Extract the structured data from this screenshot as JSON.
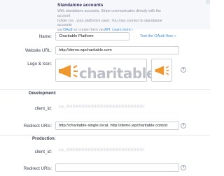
{
  "standalone": {
    "title": "Standalone accounts",
    "text_1": "With standalone accounts, Stripe communicates directly with the account",
    "text_2": "holder (i.e., your platform's user). You may connect to standalone accounts",
    "text_3_prefix": "via ",
    "text_3_link1": "OAuth",
    "text_3_mid": " or create them via ",
    "text_3_link2": "API",
    "text_3_sep": ". ",
    "text_3_link3": "Learn more ›"
  },
  "form": {
    "name_label": "Name:",
    "name_value": "Charitable Platform",
    "test_oauth_link": "Test the OAuth flow »",
    "website_label": "Website URL:",
    "website_value": "http://demo.wpcharitable.com",
    "logo_label": "Logo & Icon:",
    "logo_text": "charitable",
    "help_glyph": "?"
  },
  "development": {
    "section_label": "Development:",
    "client_id_label": "client_id:",
    "client_id_value": "ca_XXXXXXXXXXXXXXXXXXXXXXXXXXXXXXXXX",
    "redirect_label": "Redirect URIs:",
    "redirect_value": "http://charitable-single.local, http://demo.wpcharitable.com/st"
  },
  "production": {
    "section_label": "Production:",
    "client_id_label": "client_id:",
    "client_id_value": "ca_XXXXXXXXXXXXXXXXXXXXXXXXXXXXXXXXX",
    "redirect_label": "Redirect URIs:",
    "redirect_value": ""
  },
  "colors": {
    "accent_orange": "#f0962e",
    "link_blue": "#3f8fd8"
  }
}
